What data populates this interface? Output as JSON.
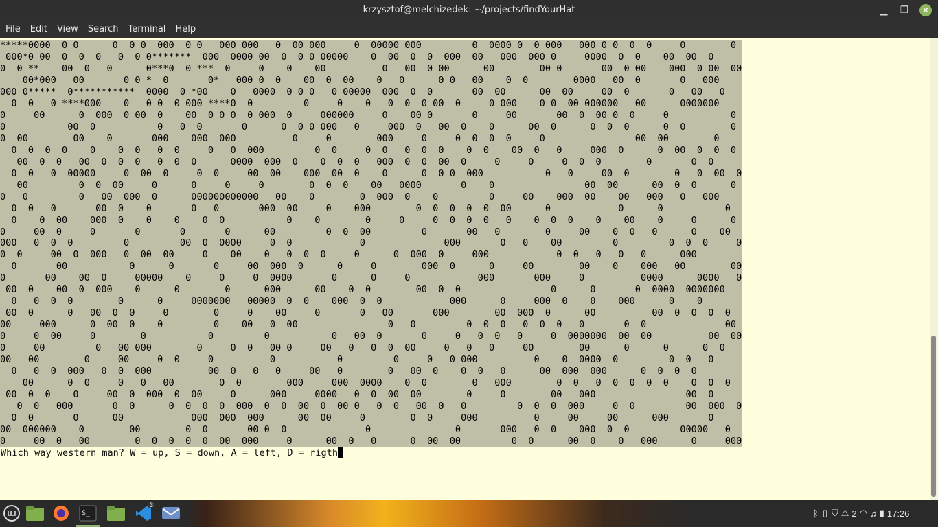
{
  "window": {
    "title": "krzysztof@melchizedek: ~/projects/findYourHat"
  },
  "menu": [
    "File",
    "Edit",
    "View",
    "Search",
    "Terminal",
    "Help"
  ],
  "terminal": {
    "grid_rows": [
      "*****0000  0 0      0  0 0  000  0 0   000 000   0  00 000     0  00000 000         0  0000 0  0 000   000 0 0  0  0     0        0     0",
      " 000*0 00  0  0  0   0  0 0*******  000  0000 00  0  0 0 00000    0  00  0  0  000  00   000  000 0     0000  0  0    00  00  0       0",
      "0  0 **    00  0   0      0***0  0 ***  0     0    0    00          0   00  0 00      00        00 0       00  0 00    000  0 00  00  0  0      0000000",
      "    00*000   00       0 0 *  0       0*   000 0  0    00  0  00    0   0      0 0   00    0  0        0000   00  0       0   000        00  00",
      "000 0*****  0***********  0000  0 *00    0   0000  0 0 0   0 00000  000  0  0       00  00      00  00     00  0       0   00   0      0  00  00      0",
      "  0  0   0 ****000    0   0 0  0 000 ****0  0         0     0    0   0  0  0 00  0     0 000    0 0  00 000000   00      0000000      0   00000000    0    0",
      "0     00      0  000  0 00  0    00  0 0 0  0 000  0     000000     0    00 0       0     00       00  0  00 0  0     0           0 0         0  0  00  0  0  000",
      "0           00  0           0   0  0       0      0  0 0 000   0     000  0   00  0    0      00  0      0  0  0      0  0        0  0       00       0  0  0    00   0",
      "0  00        00    0       000    000  000          0     0        000     0     0  0  0  0     0                00  00        0     0   0000   0  00  0  00     00  0",
      "  0  0  0  0    0    0  0   0  0     0   0  000         0  0     0  0   0  0  0    0  0    00  0   0     000  0      0  00  0  0  0     0    0  0  00   0  00  0",
      "   00  0  0   00  0  0  0   0  0  0      0000  000  0    0  0  0   000  0  0  00  0     0     0     0  0  0        0       0  0        0   00  000    00    0    0  0",
      "  0  0   0  00000     0  00  0     0  0     00  00    000  00  0    0      0  0 0  000           0   0     00  0        0   0  00  0  0  00     0  0    0   0",
      "   00         0  0  00     0      0     0     0        0  0  0    00   0000       0    0                00  00      00  0  0      0   00  0     0  0  00  0     00      0",
      "0   0         0   00  000  0      000000000000   00    0        0  000  0    0         0     00    000  00    00   000   0   000            000      0",
      "  0  0   0       00  0    0       0   0       000  00     0    000        0  0  0  0  0  00      0            0      0           0      00   00  000     0   0  0000  0  0      0000",
      "  0    0  00    000  0    0    0    0  0           0    0        0     0     0  0  0  0   0    0  0  0    0    00    0     0      0   0 0 00   0   00  00   0  0   0   0",
      "0     00  0     0       0       0       0      00         0  0  00         0       00   0        0     00    0  0   0      0    00     0  0  0  00   0     00  0  000   0  0",
      "000   0  0  0         0         00  0  0000     0  0            0              000       0   0    00         0         0  0  0     0     00    0  00     00    0          0   0",
      "0  0     00  0  000   0  00  00     0    00    0   0  0  0     0      0  000  0     000            0  0   0   0   0      000          0    0       000  0         0  000    000",
      "  0       00           0      0       0     00  000  0      0     0        000  0      0     00        00    0    000   00        00  0  0  0  0                   0    0  00  0  0",
      "0       00    00  0     00000    0     0     0  0000       0      0     0            000       000     0          0000      0000   0   00000  0  0     00     0  0  000          0",
      " 00  0    00  0  000    0      0        0      000      00    0  0        00  0  0                0      0       0  0000  0000000      0        00   000     0  0  0  0      0   0   0",
      "  0   0  0  0        0      0     0000000   00000  0  0    000  0  0            000      0     000  0    0    000      0    0          0    0  00   0  0   0   0     00        0",
      " 00  0      0   00  0  0     0        0     0    00     0       0   00       000        00  000  0      00          00  0  0  0  0  0  0           0000000        0  00       000",
      "00     000      0  00  0    0         0    00   0  00                0   0         0  0  0   0  0  0   0       0  0              00     0  000         0  0            00    000  0  000",
      "0     0  00     0        0           0         0           0   00  0       0     0   0  0   0     0  0000000  00  00          00  00  00             0     00              00  00  0  00   0  00",
      "0     00         0   00 000        0     0  0   00 0     00   0   0  0  00     0   0   0     00        00      0      0      0  0        0           0 0  00   0  0   0   0000    00  0  0  00",
      "00   00        0     00     0  0     0          0           0         0     0   0 000          0    0  0000  0         0  0   0      0   0  0     0       00  00  0  0  0   0           00   000",
      "  0   0  0  000   0  0  000          00  0   0   0     00   0        0   00  0    0  0   0      00  000  000      0  0  0  0        0    0   000  0  0    0    0  0  0   0    0   00  0  0  000  0",
      "    00      0  0     0   0   00        0  0        000     000  0000    0  0        0   000        0  0   0  0  0  0  0    0  0  0  0       0        0     0    0      0     0   0  0",
      " 00  0  0    0     00  0  000  0  00     0      000     0000   0  0  00  00        0     0        00   000                00  0                    0  0  00           0   00        000  0  0",
      "   0  0   000       0  0      0  0  0  0  000  0  0  00  0  00 0   0  0   00  0   0         0  0  0  000     0  0         00  000  0      00   0  00  0  0000        0          000   0",
      "  0  0       0      00            000  000  000      00  00     0        0  0     000          0     00     00      000       0           0  0          000  ^   0     000  00      0    00  0",
      "00  000000    0        00        0  0       00 0  0              0               0       000   0  0    000  0  0         00000   0    0               00          0       00  0  0  0   00  0",
      "0     00  0   00        0  0  0  0  0  00  000     0      00  0   0      0  00  00         0  0      00  0    0   000      0     0000000   00    0   0   0   000       0        00  0  0    0"
    ],
    "prompt": "Which way western man? W = up, S = down, A = left, D = rigth"
  },
  "taskbar": {
    "apps": [
      "menu-icon",
      "files-icon",
      "firefox-icon",
      "terminal-icon",
      "folder-icon",
      "vscode-icon",
      "mail-icon"
    ],
    "vscode_badge": "3",
    "workspace": "2",
    "clock": "17:26"
  }
}
